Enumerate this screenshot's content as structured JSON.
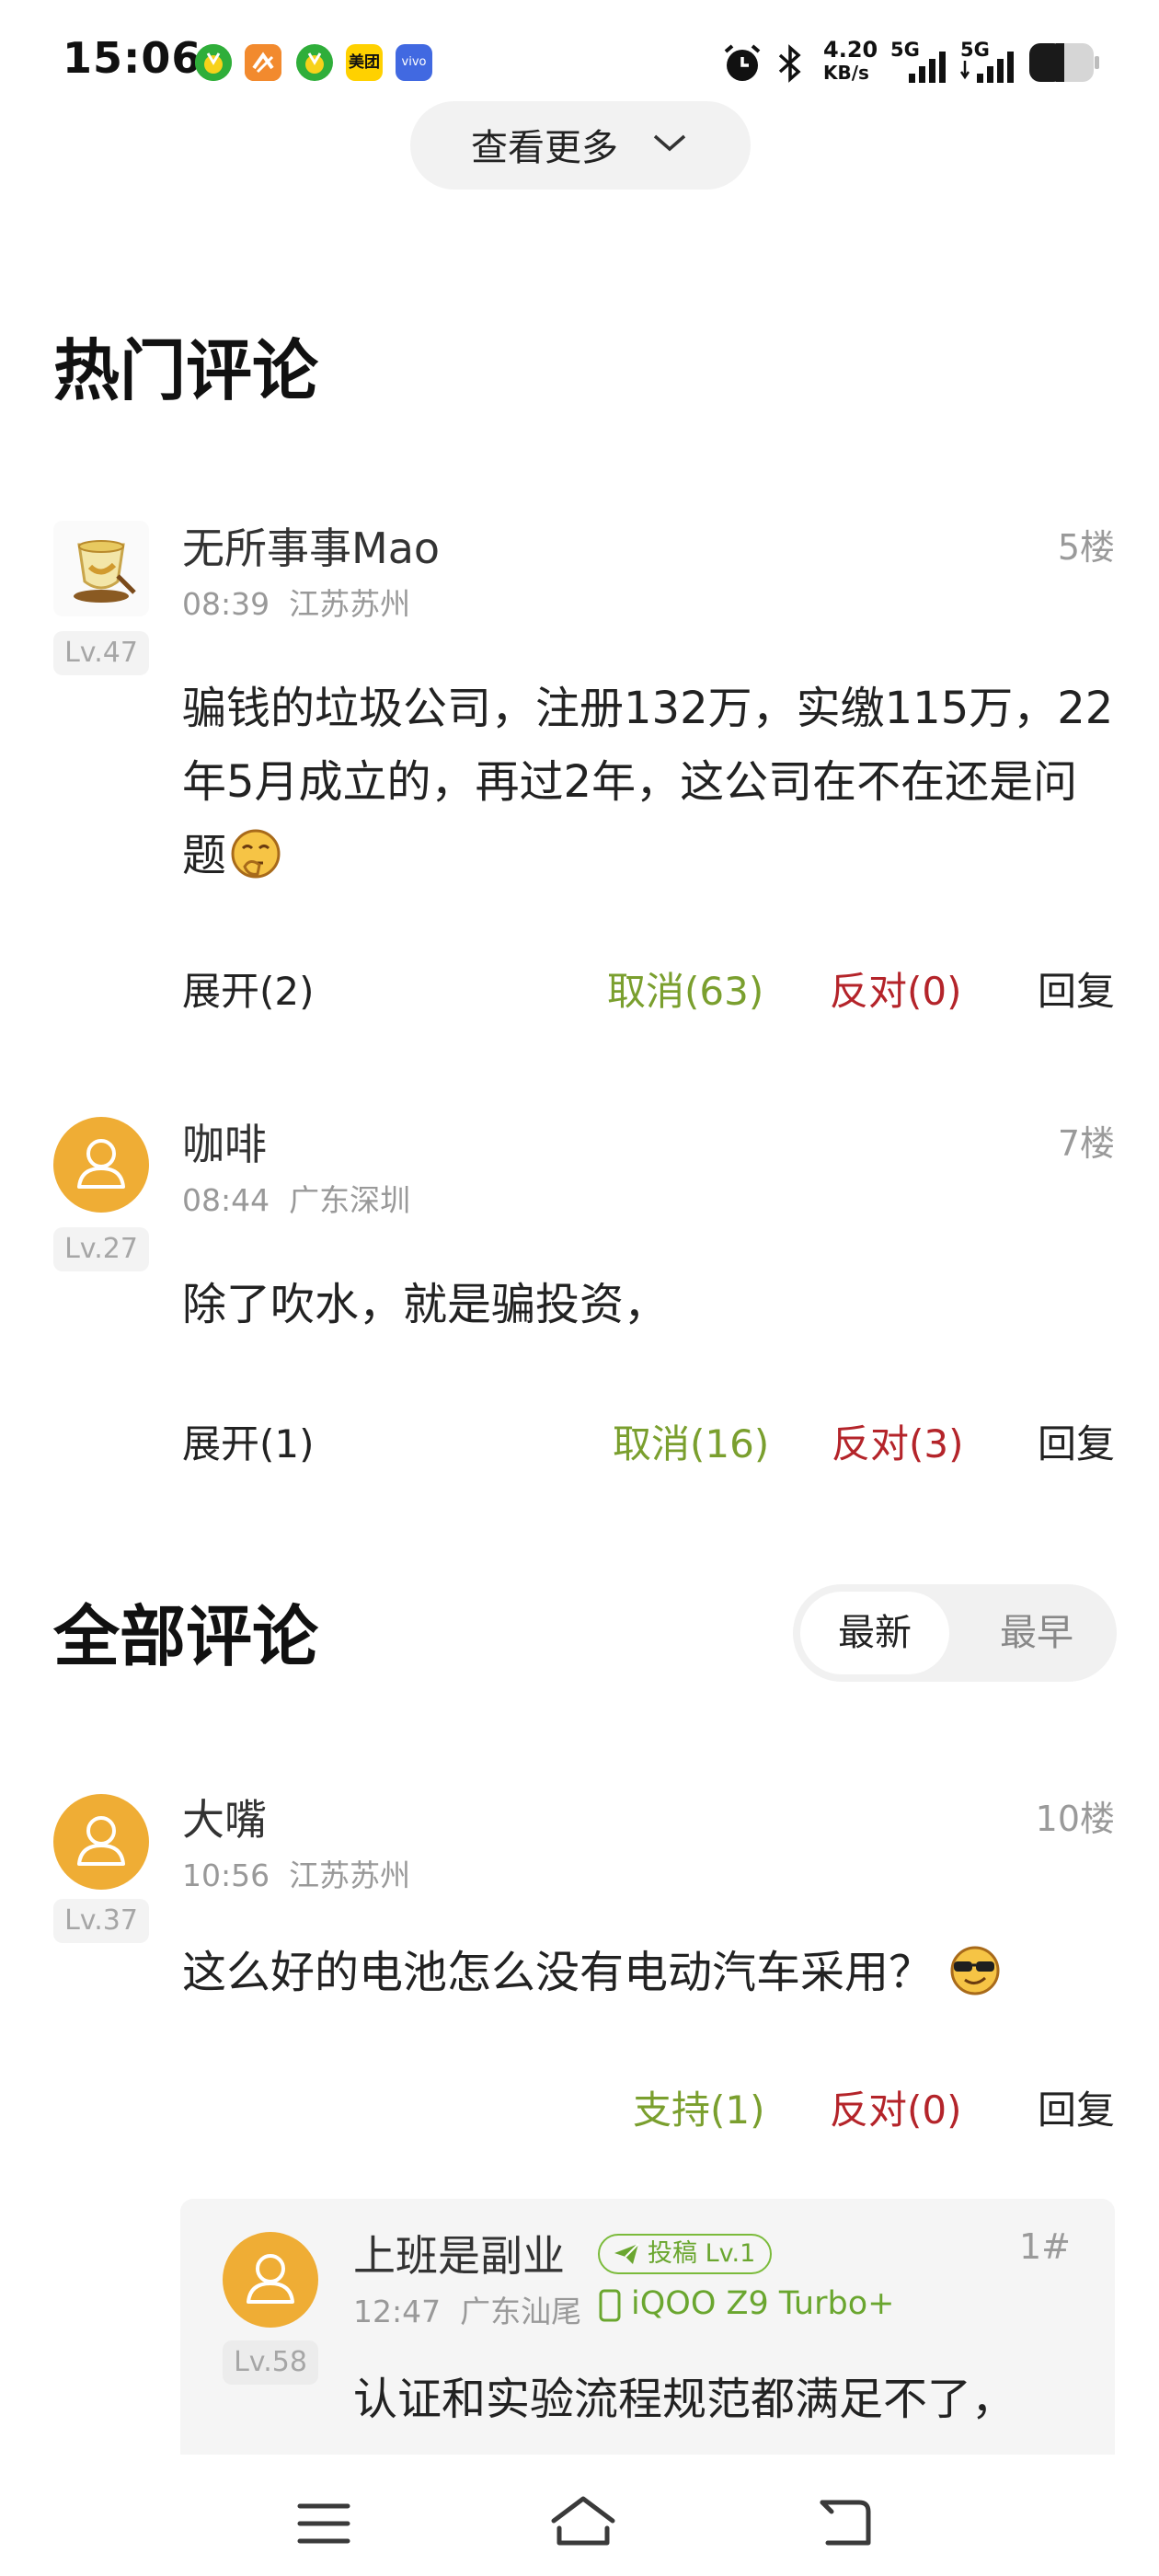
{
  "status_bar": {
    "time": "15:06",
    "app_icons": [
      "music-icon",
      "wallet-icon",
      "music-icon",
      "meituan-icon",
      "vivo-icon"
    ],
    "meituan_label": "美团",
    "vivo_label": "vivo",
    "net_speed_value": "4.20",
    "net_speed_unit": "KB/s",
    "signal1_label": "5G",
    "signal2_label": "5G",
    "battery_level": 0.55
  },
  "more_button": {
    "label": "查看更多"
  },
  "hot_section": {
    "title": "热门评论"
  },
  "hot_comments": [
    {
      "username": "无所事事Mao",
      "time": "08:39",
      "location": "江苏苏州",
      "floor": "5楼",
      "level": "Lv.47",
      "text": "骗钱的垃圾公司，注册132万，实缴115万，22年5月成立的，再过2年，这公司在不在还是问题",
      "emoji": "thinking-emoji",
      "expand": "展开(2)",
      "support": "取消(63)",
      "oppose": "反对(0)",
      "reply": "回复"
    },
    {
      "username": "咖啡",
      "time": "08:44",
      "location": "广东深圳",
      "floor": "7楼",
      "level": "Lv.27",
      "text": "除了吹水，就是骗投资，",
      "expand": "展开(1)",
      "support": "取消(16)",
      "oppose": "反对(3)",
      "reply": "回复"
    }
  ],
  "all_section": {
    "title": "全部评论",
    "sort_options": [
      "最新",
      "最早"
    ],
    "selected_sort": "最新"
  },
  "all_comments": [
    {
      "username": "大嘴",
      "time": "10:56",
      "location": "江苏苏州",
      "floor": "10楼",
      "level": "Lv.37",
      "text": "这么好的电池怎么没有电动汽车采用？",
      "emoji": "cool-emoji",
      "support": "支持(1)",
      "oppose": "反对(0)",
      "reply": "回复",
      "sub_reply": {
        "username": "上班是副业",
        "badge": "投稿 Lv.1",
        "time": "12:47",
        "location": "广东汕尾",
        "device": "iQOO Z9 Turbo+",
        "floor": "1#",
        "level": "Lv.58",
        "text": "认证和实验流程规范都满足不了，"
      }
    }
  ],
  "colors": {
    "accent_green": "#7a9f2e",
    "oppose_red": "#b4242a",
    "avatar_orange": "#efad35",
    "badge_green": "#7bbb3b"
  },
  "nav_bar": {
    "icons": [
      "menu-icon",
      "home-icon",
      "back-icon"
    ]
  }
}
